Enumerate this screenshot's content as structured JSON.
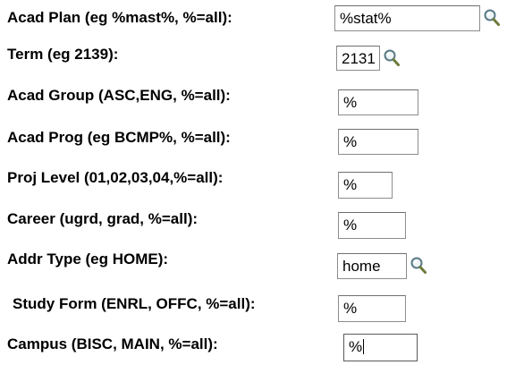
{
  "fields": [
    {
      "label": "Acad Plan (eg %mast%, %=all):",
      "value": "%stat%"
    },
    {
      "label": "Term (eg 2139):",
      "value": "2131"
    },
    {
      "label": "Acad Group (ASC,ENG, %=all):",
      "value": "%"
    },
    {
      "label": "Acad Prog (eg BCMP%, %=all):",
      "value": "%"
    },
    {
      "label": "Proj Level (01,02,03,04,%=all):",
      "value": "%"
    },
    {
      "label": "Career (ugrd, grad, %=all):",
      "value": "%"
    },
    {
      "label": "Addr Type (eg HOME):",
      "value": "home"
    },
    {
      "label": "Study Form (ENRL, OFFC, %=all):",
      "value": "%"
    },
    {
      "label": "Campus (BISC, MAIN, %=all):",
      "value": "%"
    }
  ],
  "icons": {
    "lookup": "magnifying-glass-icon"
  }
}
